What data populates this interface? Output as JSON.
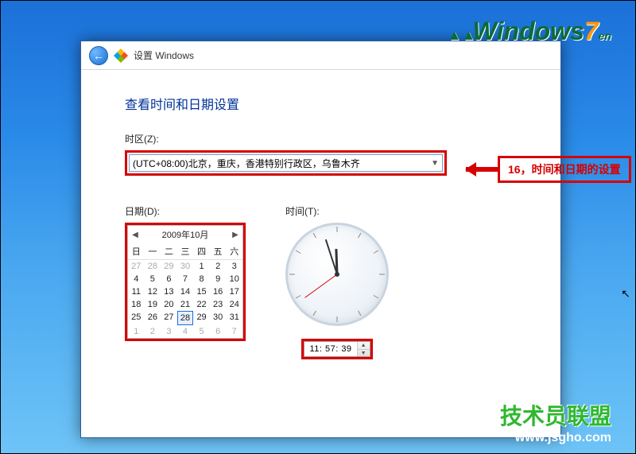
{
  "watermark": {
    "top_brand_prefix": "W",
    "top_brand_mid": "indows",
    "top_brand_seven": "7",
    "top_brand_suffix": "en",
    "bottom_title": "技术员联盟",
    "bottom_url": "www.jsgho.com"
  },
  "titlebar": {
    "text": "设置 Windows"
  },
  "heading": "查看时间和日期设置",
  "labels": {
    "timezone": "时区(Z):",
    "date": "日期(D):",
    "time": "时间(T):"
  },
  "timezone": {
    "selected": "(UTC+08:00)北京，重庆，香港特别行政区，乌鲁木齐"
  },
  "calendar": {
    "month_label": "2009年10月",
    "dow": [
      "日",
      "一",
      "二",
      "三",
      "四",
      "五",
      "六"
    ],
    "weeks": [
      [
        27,
        28,
        29,
        30,
        1,
        2,
        3
      ],
      [
        4,
        5,
        6,
        7,
        8,
        9,
        10
      ],
      [
        11,
        12,
        13,
        14,
        15,
        16,
        17
      ],
      [
        18,
        19,
        20,
        21,
        22,
        23,
        24
      ],
      [
        25,
        26,
        27,
        28,
        29,
        30,
        31
      ],
      [
        1,
        2,
        3,
        4,
        5,
        6,
        7
      ]
    ],
    "prev_trailing_row0": 4,
    "next_leading_row5": 7,
    "selected_day": 28,
    "selected_row": 4
  },
  "time": {
    "value": "11: 57: 39",
    "hour_angle": 358,
    "minute_angle": 342,
    "second_angle": 234
  },
  "annotation": {
    "text": "16，时间和日期的设置"
  }
}
